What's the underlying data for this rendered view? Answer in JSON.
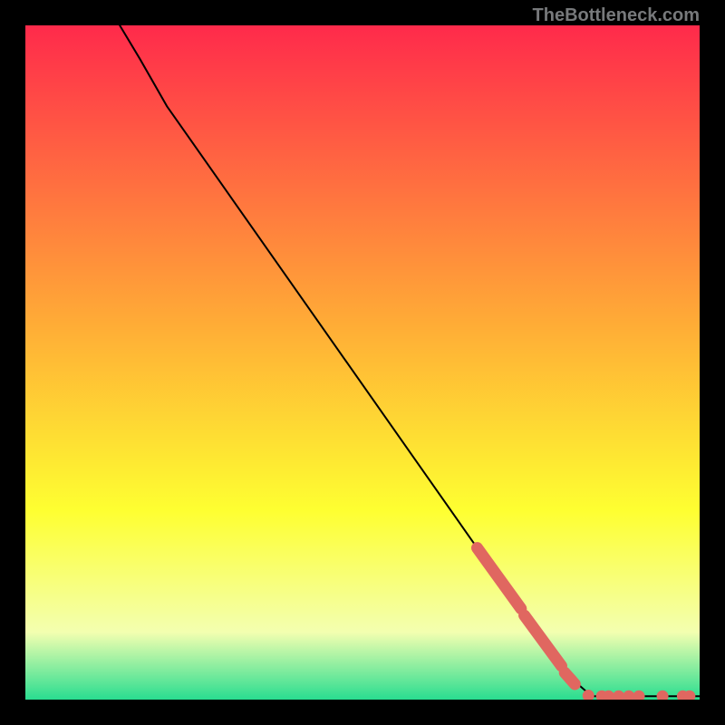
{
  "attribution": "TheBottleneck.com",
  "chart_data": {
    "type": "line",
    "title": "",
    "xlabel": "",
    "ylabel": "",
    "xlim": [
      0,
      100
    ],
    "ylim": [
      0,
      100
    ],
    "background_gradient_top": "#ff2a4b",
    "background_gradient_mid_1": "#ffae36",
    "background_gradient_mid_2": "#feff31",
    "background_gradient_low": "#f3ffb0",
    "background_gradient_bottom": "#29dd90",
    "curve": [
      {
        "x": 14,
        "y": 100
      },
      {
        "x": 17,
        "y": 95
      },
      {
        "x": 21,
        "y": 88
      },
      {
        "x": 80,
        "y": 4
      },
      {
        "x": 84,
        "y": 0.5
      },
      {
        "x": 100,
        "y": 0.5
      }
    ],
    "highlighted_segments": [
      {
        "points": [
          {
            "x": 67,
            "y": 22.5
          },
          {
            "x": 73.5,
            "y": 13.5
          }
        ]
      },
      {
        "points": [
          {
            "x": 74,
            "y": 12.5
          },
          {
            "x": 79.5,
            "y": 5
          }
        ]
      },
      {
        "points": [
          {
            "x": 80,
            "y": 4
          },
          {
            "x": 81.5,
            "y": 2.3
          }
        ]
      }
    ],
    "highlighted_points": [
      {
        "x": 83.5,
        "y": 0.6
      },
      {
        "x": 85.5,
        "y": 0.5
      },
      {
        "x": 86.5,
        "y": 0.5
      },
      {
        "x": 88.0,
        "y": 0.5
      },
      {
        "x": 89.5,
        "y": 0.5
      },
      {
        "x": 91.0,
        "y": 0.5
      },
      {
        "x": 94.5,
        "y": 0.5
      },
      {
        "x": 97.5,
        "y": 0.5
      },
      {
        "x": 98.5,
        "y": 0.5
      }
    ],
    "highlight_color": "#e06760",
    "curve_color": "#000000"
  }
}
